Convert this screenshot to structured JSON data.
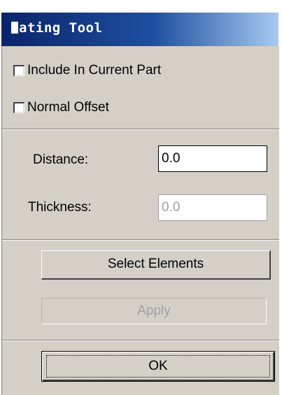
{
  "window": {
    "title_first_glyph_icon": "block-glyph",
    "title_text": "ating Tool"
  },
  "options": {
    "include_in_current_part": {
      "label": "Include In Current Part",
      "checked": false
    },
    "normal_offset": {
      "label": "Normal Offset",
      "checked": false
    }
  },
  "fields": {
    "distance": {
      "label": "Distance:",
      "value": "0.0",
      "enabled": true
    },
    "thickness": {
      "label": "Thickness:",
      "value": "0.0",
      "enabled": false
    }
  },
  "buttons": {
    "select_elements": "Select Elements",
    "apply": "Apply",
    "ok": "OK"
  },
  "colors": {
    "title_gradient_start": "#0a246a",
    "title_gradient_end": "#a6caf0",
    "panel_bg": "#d4d0c8",
    "disabled_text": "#a0a0a0"
  }
}
